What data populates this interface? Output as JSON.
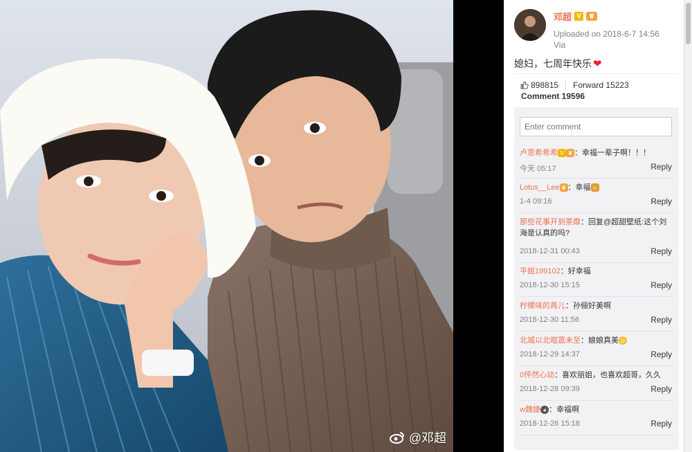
{
  "post": {
    "username": "邓超",
    "uploaded": "Uploaded on 2018-6-7 14:56",
    "via": "Via",
    "text": "媳妇，七周年快乐",
    "likes": "898815",
    "forward": "Forward 15223",
    "comment_count": "Comment 19596",
    "comment_placeholder": "Enter comment"
  },
  "watermark": {
    "text": "@邓超"
  },
  "comments": [
    {
      "name": "卢思希希希",
      "text": "：幸福一辈子啊！！！",
      "time": "今天 05:17",
      "reply": "Reply"
    },
    {
      "name": "Lotus__Lee",
      "text": "：幸福",
      "time": "1-4 09:16",
      "reply": "Reply"
    },
    {
      "name": "那些花事开到荼靡",
      "text": "：回复@超甜壁纸:这个刘海是认真的吗?",
      "mention": "@超甜壁纸",
      "time": "2018-12-31 00:43",
      "reply": "Reply"
    },
    {
      "name": "平姐199102",
      "text": "：好幸福",
      "time": "2018-12-30 15:15",
      "reply": "Reply"
    },
    {
      "name": "柠檬味的苒儿",
      "text": "：孙俪好美啊",
      "time": "2018-12-30 11:56",
      "reply": "Reply"
    },
    {
      "name": "北城以北暄嚣未至",
      "text": "：娘娘真美",
      "time": "2018-12-29 14:37",
      "reply": "Reply"
    },
    {
      "name": "0怦然心动",
      "text": "：喜欢丽姐，也喜欢超哥，久久",
      "time": "2018-12-28 09:39",
      "reply": "Reply"
    },
    {
      "name": "w魏婕",
      "text": "：幸福啊",
      "time": "2018-12-26 15:18",
      "reply": "Reply"
    }
  ],
  "colors": {
    "name": "#eb7350",
    "brand": "#f7b500",
    "heart": "#e5212a"
  },
  "icons": [
    "weibo-logo-icon",
    "verified-v-icon",
    "crown-icon",
    "thumbs-up-icon",
    "heart-icon",
    "emoji-icon"
  ]
}
